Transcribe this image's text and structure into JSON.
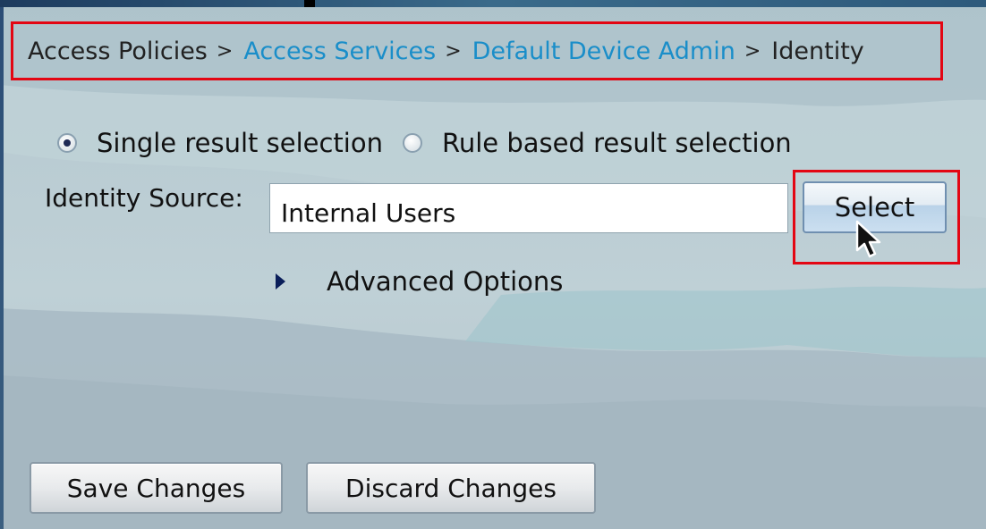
{
  "breadcrumb": {
    "items": [
      {
        "label": "Access Policies",
        "link": false
      },
      {
        "label": "Access Services",
        "link": true
      },
      {
        "label": "Default Device Admin",
        "link": true
      },
      {
        "label": "Identity",
        "link": false
      }
    ],
    "separator": ">"
  },
  "result_selection": {
    "single_label": "Single result selection",
    "rule_label": "Rule based result selection",
    "selected": "single"
  },
  "identity_source": {
    "label": "Identity Source:",
    "value": "Internal Users",
    "select_label": "Select"
  },
  "advanced": {
    "label": "Advanced Options",
    "expanded": false
  },
  "footer": {
    "save_label": "Save Changes",
    "discard_label": "Discard Changes"
  },
  "colors": {
    "highlight": "#e30613",
    "link": "#1a8ec9",
    "background": "#b9ccd1"
  }
}
